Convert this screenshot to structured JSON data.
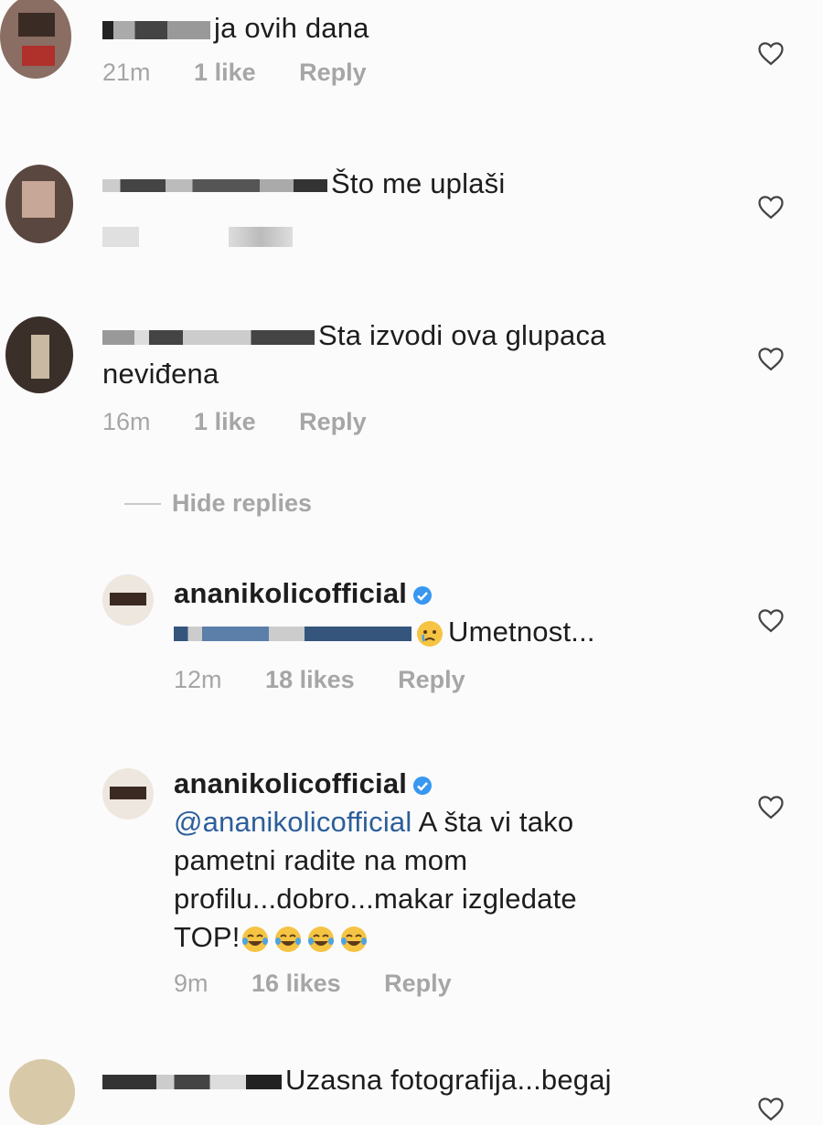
{
  "comments": [
    {
      "text": "ja ovih dana",
      "time": "21m",
      "likes": "1 like",
      "reply": "Reply"
    },
    {
      "text": "Što me uplaši"
    },
    {
      "text": "Sta izvodi ova glupaca",
      "text2": "neviđena",
      "time": "16m",
      "likes": "1 like",
      "reply": "Reply"
    },
    {
      "username": "ananikolicofficial",
      "text": "Umetnost...",
      "time": "12m",
      "likes": "18 likes",
      "reply": "Reply"
    },
    {
      "username": "ananikolicofficial",
      "mention": "@ananikolicofficial",
      "text_line1": "A šta vi tako",
      "text_line2": "pametni radite na mom",
      "text_line3": "profilu...dobro...makar izgledate",
      "text_line4": "TOP!",
      "time": "9m",
      "likes": "16 likes",
      "reply": "Reply"
    },
    {
      "text": "Uzasna fotografija...begaj"
    }
  ],
  "hide_replies": "Hide replies",
  "icons": {
    "like": "heart-outline-icon",
    "verified": "verified-badge-icon",
    "crying": "crying-face-emoji",
    "laughing": "tears-of-joy-emoji"
  },
  "colors": {
    "verified": "#3897f0",
    "mention": "#2c5e9a",
    "meta": "#a6a6a6"
  }
}
